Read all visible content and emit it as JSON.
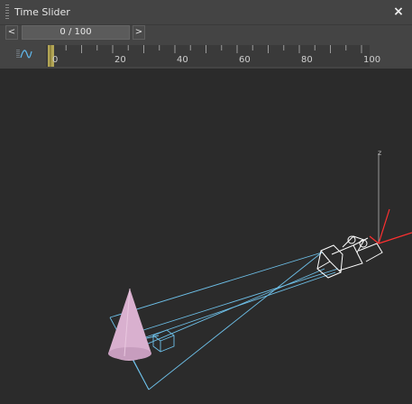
{
  "window": {
    "title": "Time Slider",
    "close_glyph": "×"
  },
  "controls": {
    "prev_label": "<",
    "next_label": ">",
    "frame_display": "0 / 100",
    "current_frame": 0,
    "total_frames": 100
  },
  "timeline": {
    "tick_labels": [
      "0",
      "20",
      "40",
      "60",
      "80",
      "100"
    ],
    "curve_icon": "curve-editor-icon"
  },
  "viewport": {
    "axis_label": "z",
    "objects": [
      "cone",
      "camera",
      "camera-target"
    ],
    "colors": {
      "cone": "#d9b0cf",
      "camera": "#ffffff",
      "frustum": "#6ec1ea",
      "axis_x": "#ff3030",
      "axis_z": "#9a9a9a"
    }
  }
}
